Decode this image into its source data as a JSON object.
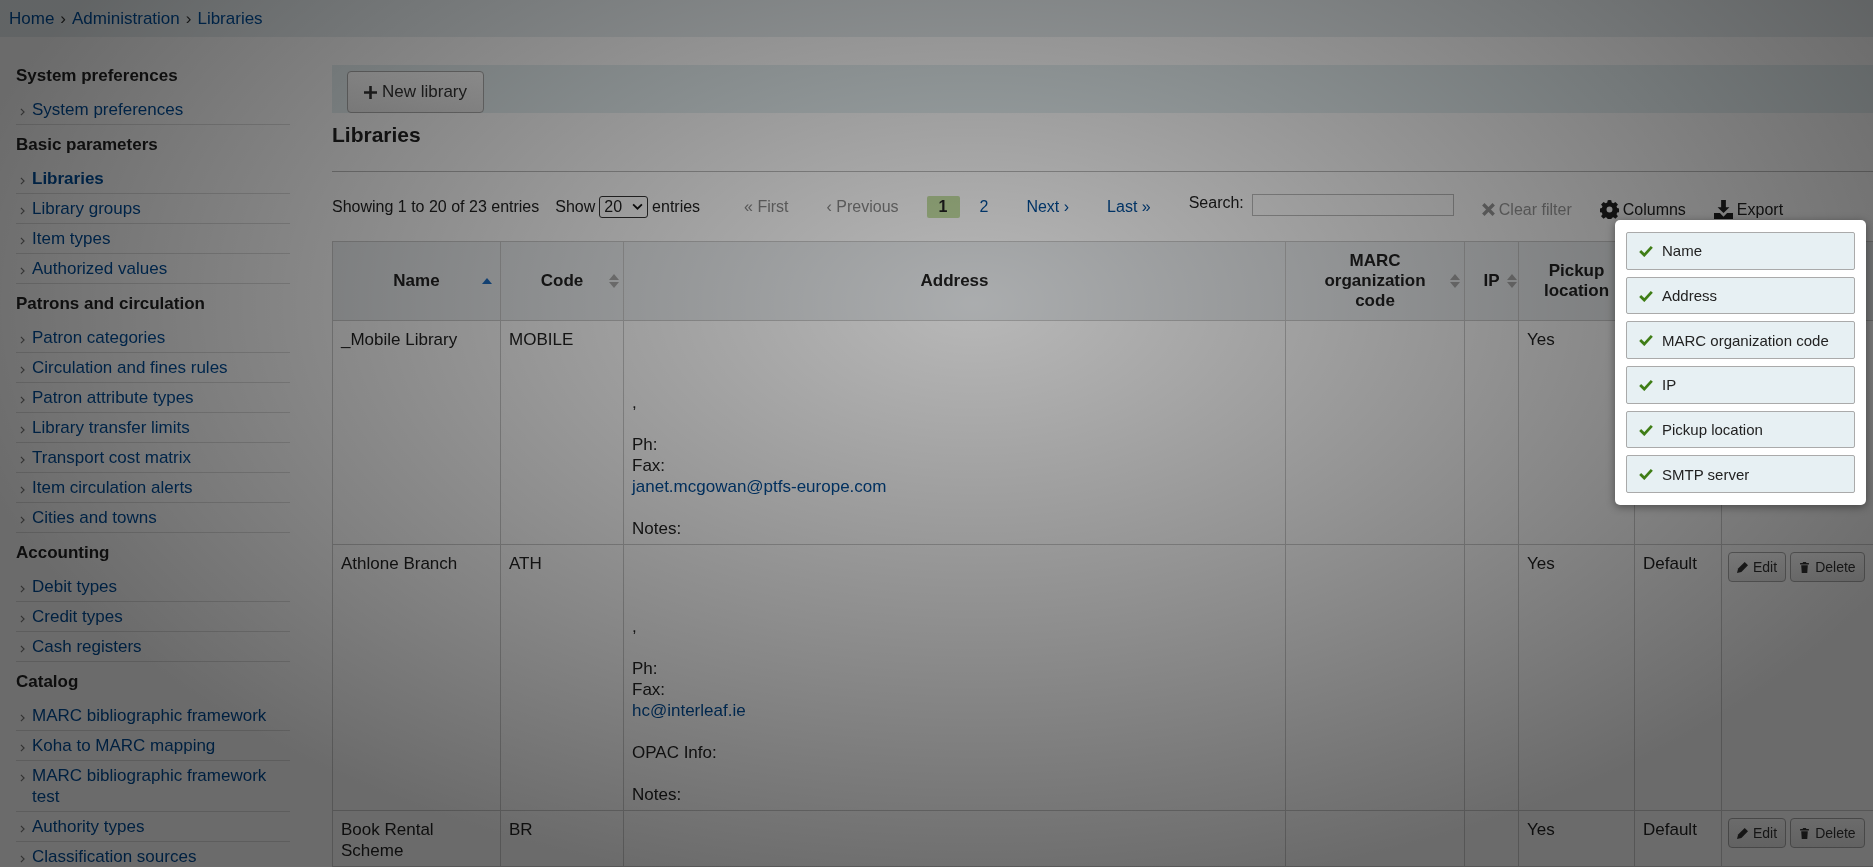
{
  "breadcrumbs": {
    "separator": "›",
    "items": [
      {
        "label": "Home"
      },
      {
        "label": "Administration"
      },
      {
        "label": "Libraries"
      }
    ]
  },
  "sidebar": [
    {
      "title": "System preferences",
      "items": [
        {
          "label": "System preferences",
          "selected": false
        }
      ]
    },
    {
      "title": "Basic parameters",
      "items": [
        {
          "label": "Libraries",
          "selected": true
        },
        {
          "label": "Library groups",
          "selected": false
        },
        {
          "label": "Item types",
          "selected": false
        },
        {
          "label": "Authorized values",
          "selected": false
        }
      ]
    },
    {
      "title": "Patrons and circulation",
      "items": [
        {
          "label": "Patron categories",
          "selected": false
        },
        {
          "label": "Circulation and fines rules",
          "selected": false
        },
        {
          "label": "Patron attribute types",
          "selected": false
        },
        {
          "label": "Library transfer limits",
          "selected": false
        },
        {
          "label": "Transport cost matrix",
          "selected": false
        },
        {
          "label": "Item circulation alerts",
          "selected": false
        },
        {
          "label": "Cities and towns",
          "selected": false
        }
      ]
    },
    {
      "title": "Accounting",
      "items": [
        {
          "label": "Debit types",
          "selected": false
        },
        {
          "label": "Credit types",
          "selected": false
        },
        {
          "label": "Cash registers",
          "selected": false
        }
      ]
    },
    {
      "title": "Catalog",
      "items": [
        {
          "label": "MARC bibliographic framework",
          "selected": false
        },
        {
          "label": "Koha to MARC mapping",
          "selected": false
        },
        {
          "label": "MARC bibliographic framework test",
          "selected": false
        },
        {
          "label": "Authority types",
          "selected": false
        },
        {
          "label": "Classification sources",
          "selected": false
        }
      ]
    }
  ],
  "toolbar": {
    "new_button": "New library"
  },
  "title": "Libraries",
  "table_info": "Showing 1 to 20 of 23 entries",
  "length": {
    "before": "Show",
    "value": "20",
    "after": "entries"
  },
  "pagination": [
    {
      "label": "« First",
      "disabled": true,
      "selected": false
    },
    {
      "label": "‹ Previous",
      "disabled": true,
      "selected": false
    },
    {
      "label": "1",
      "disabled": false,
      "selected": true
    },
    {
      "label": "2",
      "disabled": false,
      "selected": false
    },
    {
      "label": "Next ›",
      "disabled": false,
      "selected": false
    },
    {
      "label": "Last »",
      "disabled": false,
      "selected": false
    }
  ],
  "search": {
    "label": "Search:"
  },
  "actions": [
    {
      "kind": "clear",
      "label": "Clear filter",
      "disabled": true
    },
    {
      "kind": "columns",
      "label": "Columns",
      "disabled": false
    },
    {
      "kind": "export",
      "label": "Export",
      "disabled": false
    }
  ],
  "columns": [
    {
      "label": "Name",
      "sortable": true,
      "sorted_ascending": true
    },
    {
      "label": "Code",
      "sortable": true
    },
    {
      "label": "Address",
      "sortable": false
    },
    {
      "label": "MARC organization code",
      "sortable": true
    },
    {
      "label": "IP",
      "sortable": true
    },
    {
      "label": "Pickup location",
      "sortable": false
    }
  ],
  "rows": [
    {
      "name": "_Mobile Library",
      "code": "MOBILE",
      "address": [
        {
          "kind": "blank"
        },
        {
          "kind": "blank"
        },
        {
          "kind": "blank"
        },
        {
          "kind": "text",
          "text": ","
        },
        {
          "kind": "blank"
        },
        {
          "kind": "text",
          "text": "Ph:"
        },
        {
          "kind": "text",
          "text": "Fax:"
        },
        {
          "kind": "link",
          "text": "janet.mcgowan@ptfs-europe.com"
        },
        {
          "kind": "blank"
        },
        {
          "kind": "text",
          "text": "Notes:"
        }
      ],
      "pickup": "Yes"
    },
    {
      "name": "Athlone Branch",
      "code": "ATH",
      "address": [
        {
          "kind": "blank"
        },
        {
          "kind": "blank"
        },
        {
          "kind": "blank"
        },
        {
          "kind": "text",
          "text": ","
        },
        {
          "kind": "blank"
        },
        {
          "kind": "text",
          "text": "Ph:"
        },
        {
          "kind": "text",
          "text": "Fax:"
        },
        {
          "kind": "link",
          "text": "hc@interleaf.ie"
        },
        {
          "kind": "blank"
        },
        {
          "kind": "text",
          "text": "OPAC Info:"
        },
        {
          "kind": "blank"
        },
        {
          "kind": "text",
          "text": "Notes:"
        }
      ],
      "pickup": "Yes",
      "smtp": "Default",
      "buttons": [
        {
          "kind": "edit",
          "label": "Edit"
        },
        {
          "kind": "delete",
          "label": "Delete"
        }
      ]
    },
    {
      "name": "Book Rental Scheme",
      "code": "BR",
      "address": [],
      "pickup": "Yes",
      "smtp": "Default",
      "buttons": [
        {
          "kind": "edit",
          "label": "Edit"
        },
        {
          "kind": "delete",
          "label": "Delete"
        }
      ]
    }
  ],
  "columns_menu": [
    {
      "label": "Name",
      "checked": true
    },
    {
      "label": "Address",
      "checked": true
    },
    {
      "label": "MARC organization code",
      "checked": true
    },
    {
      "label": "IP",
      "checked": true
    },
    {
      "label": "Pickup location",
      "checked": true
    },
    {
      "label": "SMTP server",
      "checked": true
    }
  ]
}
